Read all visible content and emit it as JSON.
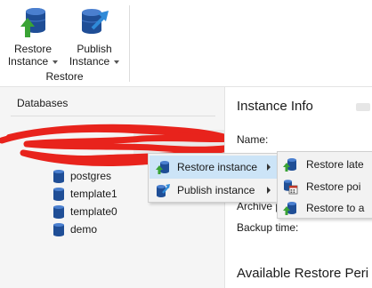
{
  "ribbon": {
    "restore_button": {
      "line1": "Restore",
      "line2": "Instance",
      "icon": "restore-database-icon"
    },
    "publish_button": {
      "line1": "Publish",
      "line2": "Instance",
      "icon": "publish-database-icon"
    },
    "group_label": "Restore"
  },
  "left_panel": {
    "title": "Databases",
    "redacted_instance": "",
    "databases": [
      {
        "label": "postgres",
        "icon": "database-icon"
      },
      {
        "label": "template1",
        "icon": "database-icon"
      },
      {
        "label": "template0",
        "icon": "database-icon"
      },
      {
        "label": "demo",
        "icon": "database-icon"
      }
    ]
  },
  "instance_info": {
    "title": "Instance Info",
    "name_label": "Name:",
    "archive_label": "Archive p",
    "backup_time_label": "Backup time:",
    "restore_periods_title": "Available Restore Peri"
  },
  "context_menu": {
    "items": [
      {
        "label": "Restore instance",
        "icon": "restore-database-icon",
        "highlighted": true,
        "has_submenu": true
      },
      {
        "label": "Publish instance",
        "icon": "publish-database-icon",
        "highlighted": false,
        "has_submenu": true
      }
    ]
  },
  "submenu": {
    "items": [
      {
        "label": "Restore late",
        "icon": "restore-latest-icon"
      },
      {
        "label": "Restore poi",
        "icon": "restore-point-icon"
      },
      {
        "label": "Restore to a",
        "icon": "restore-to-icon"
      }
    ]
  },
  "colors": {
    "database_blue": "#1f4e96",
    "restore_arrow_green": "#3aa335",
    "publish_arrow_blue": "#2f8ad8",
    "menu_highlight": "#cce4f7",
    "redaction_red": "#e8231c"
  }
}
